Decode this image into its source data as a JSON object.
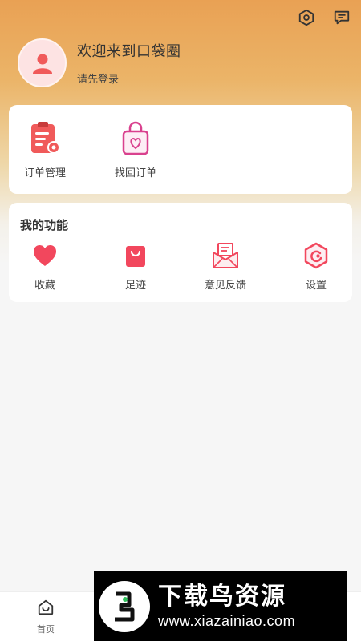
{
  "profile": {
    "welcome": "欢迎来到口袋圈",
    "login_hint": "请先登录"
  },
  "top_icons": [
    "settings-icon",
    "message-icon"
  ],
  "orders": [
    {
      "label": "订单管理",
      "icon": "order-manage-icon"
    },
    {
      "label": "找回订单",
      "icon": "retrieve-order-icon"
    }
  ],
  "functions": {
    "title": "我的功能",
    "items": [
      {
        "label": "收藏",
        "icon": "heart-icon"
      },
      {
        "label": "足迹",
        "icon": "footprint-bag-icon"
      },
      {
        "label": "意见反馈",
        "icon": "feedback-envelope-icon"
      },
      {
        "label": "设置",
        "icon": "settings-hex-icon"
      }
    ]
  },
  "tabbar": {
    "tabs": [
      {
        "label": "首页",
        "icon": "home-icon"
      }
    ]
  },
  "watermark": {
    "title": "下载鸟资源",
    "url": "www.xiazainiao.com"
  },
  "colors": {
    "accent": "#f2475d",
    "header_top": "#e9a154",
    "avatar_bg": "#fde3e3",
    "bag_pink": "#d9418e"
  }
}
